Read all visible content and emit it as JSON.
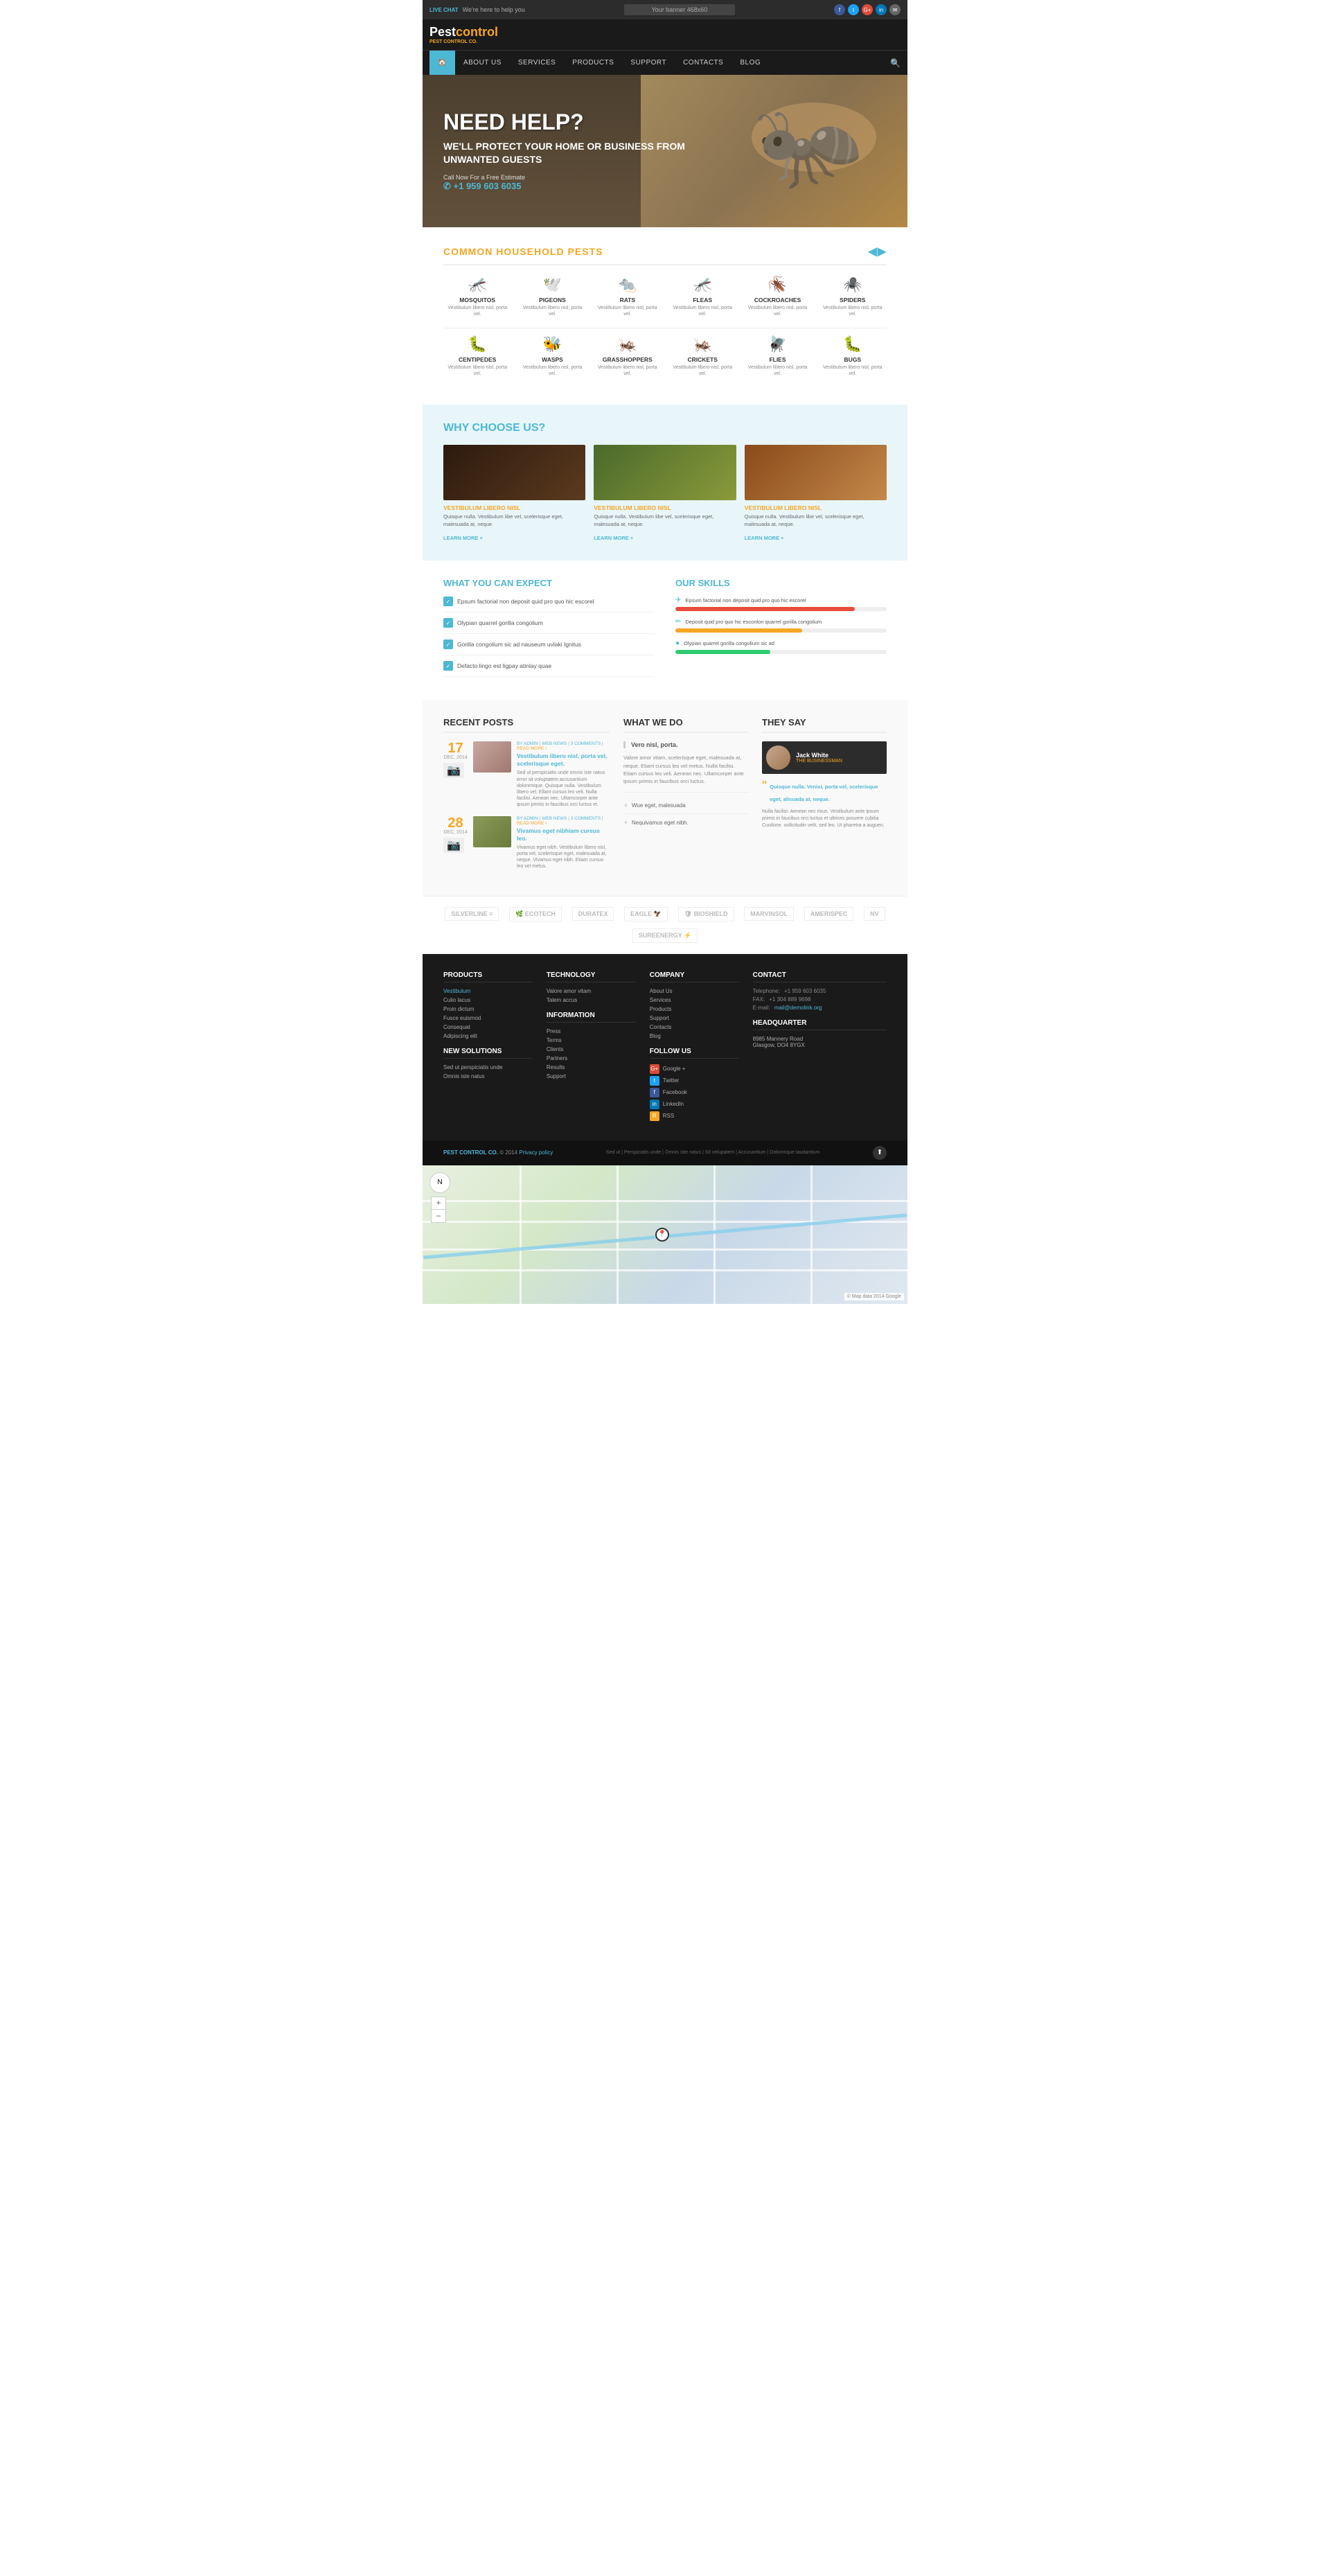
{
  "topbar": {
    "live_chat": "LIVE CHAT",
    "subtitle": "We're here to help you",
    "banner": "Your banner 468x60",
    "social": [
      "fb",
      "tw",
      "gp",
      "li",
      "em"
    ]
  },
  "logo": {
    "text_white": "Pest",
    "text_orange": "control",
    "tagline": "PEST CONTROL CO."
  },
  "nav": {
    "home": "🏠",
    "about": "ABOUT US",
    "services": "SERVICES",
    "products": "PRODUCTS",
    "support": "SUPPORT",
    "contacts": "CONTACTS",
    "blog": "BLOG"
  },
  "hero": {
    "title": "NEED HELP?",
    "subtitle": "WE'LL PROTECT YOUR HOME OR BUSINESS FROM UNWANTED GUESTS",
    "cta": "Call Now For a Free Estimate",
    "phone": "✆ +1 959 603 6035"
  },
  "pests": {
    "section_title": "COMMON HOUSEHOLD PESTS",
    "row1": [
      {
        "name": "MOSQUITOS",
        "desc": "Vestibulum libero nisl, porta vel."
      },
      {
        "name": "PIGEONS",
        "desc": "Vestibulum libero nisl, porta vel."
      },
      {
        "name": "RATS",
        "desc": "Vestibulum libero nisl, porta vel."
      },
      {
        "name": "FLEAS",
        "desc": "Vestibulum libero nisl, porta vel."
      },
      {
        "name": "COCKROACHES",
        "desc": "Vestibulum libero nisl, porta vel."
      },
      {
        "name": "SPIDERS",
        "desc": "Vestibulum libero nisl, porta vel."
      }
    ],
    "row2": [
      {
        "name": "CENTIPEDES",
        "desc": "Vestibulum libero nisl, porta vel."
      },
      {
        "name": "WASPS",
        "desc": "Vestibulum libero nisl, porta vel."
      },
      {
        "name": "GRASSHOPPERS",
        "desc": "Vestibulum libero nisl, porta vel."
      },
      {
        "name": "CRICKETS",
        "desc": "Vestibulum libero nisl, porta vel."
      },
      {
        "name": "FLIES",
        "desc": "Vestibulum libero nisl, porta vel."
      },
      {
        "name": "BUGS",
        "desc": "Vestibulum libero nisl, porta vel."
      }
    ],
    "icons_row1": [
      "🦟",
      "🕊️",
      "🐀",
      "🦟",
      "🪳",
      "🕷️"
    ],
    "icons_row2": [
      "🐛",
      "🐝",
      "🦗",
      "🦗",
      "🪰",
      "🐛"
    ]
  },
  "why": {
    "title": "WHY CHOOSE US?",
    "cards": [
      {
        "title": "VESTIBULUM LIBERO NISL",
        "text": "Quisque nulla. Vestibulum libe vel, scelerisque eget, malesuada at, neque.",
        "learn_more": "LEARN MORE +"
      },
      {
        "title": "VESTIBULUM LIBERO NISL",
        "text": "Quisque nulla. Vestibulum libe vel, scelerisque eget, malesuada at, neque.",
        "learn_more": "LEARN MORE +"
      },
      {
        "title": "VESTIBULUM LIBERO NISL",
        "text": "Quisque nulla. Vestibulum libe vel, scelerisque eget, malesuada at, neque.",
        "learn_more": "LEARN MORE +"
      }
    ]
  },
  "expect": {
    "title": "WHAT YOU CAN EXPECT",
    "items": [
      "Epsum factorial non deposit quid pro quo hic escorel",
      "Olypian quarrel  gorilla congolium",
      "Gorilla congolium sic ad nauseum uvlaki Ignitus",
      "Defacto lingo est ligpay atinlay quae"
    ]
  },
  "skills": {
    "title": "OUR SKILLS",
    "items": [
      {
        "icon": "✈",
        "label": "Epsum factorial non deposit quid pro quo hic escorel",
        "percent": 85,
        "color": "bar-red"
      },
      {
        "icon": "✏",
        "label": "Deposit quid pro quo hic esconlon quarrel  gorilla congolium",
        "percent": 60,
        "color": "bar-yellow"
      },
      {
        "icon": "●",
        "label": "Olypian quarrel  gorilla congolium sic ad",
        "percent": 45,
        "color": "bar-green"
      }
    ]
  },
  "recent_posts": {
    "title": "RECENT POSTS",
    "posts": [
      {
        "day": "17",
        "month": "DEC, 2014",
        "by": "BY ADMIN",
        "category": "WEB NEWS",
        "comments": "3 COMMENTS",
        "title": "Vestibulum libero nisl, porta vel, scelerisque eget.",
        "excerpt": "Sed ut perspiciatis unde omnis iste natus error sit voluptatem accusantium doloremque.\n\nQuisque nulla. Vestibulum libero vel. Ellam cursus leo veli. Nulla facilisi. Aenean nec. Ullamcorper ante ipsum primis in faucibus orci luctus et."
      },
      {
        "day": "28",
        "month": "DEC, 2014",
        "by": "BY ADMIN",
        "category": "WEB NEWS",
        "comments": "3 COMMENTS",
        "title": "Vivamus eget nibhiam cursus leo.",
        "excerpt": "Vivamus eget nibh. Vestibulum libero nisl, porta vel, scelerisque eget, malesuada at, neque. Vivamus eget nibh. Etiam cursus leo vel metus."
      }
    ]
  },
  "what_we_do": {
    "title": "WHAT WE DO",
    "main_text": "Vero nisl, porta.",
    "desc": "Valore amor vitam, scelerisque eget, malesuada at, neque. Etiam cursus leo vel metus. Nulla facilisi. Etiam cursus leo veli. Aenean nec. Ullamcorper ante ipsum primis in faucibus orci luctus.",
    "items": [
      "Wue eget, malesuada",
      "Nequivamus eget nibh."
    ]
  },
  "testimonial": {
    "title": "THEY SAY",
    "name": "Jack White",
    "role": "THE BUSINESSMAN",
    "quote_highlight": "Quisque nulla. Venisi, porta vel, scelerisque eget, alisuada at, neque.",
    "quote_full": "Nulla facilisi. Aenean nec risus. Vestibulum ante ipsum primis in faucibus orci luctus et ultrices posuere cubilia Cuoilone. sollicitudin velit, sed leo. Ut pharetra a auguen."
  },
  "partners": [
    "SilverLine",
    "EcoTech",
    "DuraTex",
    "Eagle",
    "BioShield",
    "MARVINSOL",
    "AmeriSpec",
    "NV",
    "SureEnergy"
  ],
  "footer": {
    "products": {
      "title": "PRODUCTS",
      "links": [
        "Vestibulum",
        "Culio lacus",
        "Proin dictum",
        "Fusce euismod",
        "Consequat",
        "Adipiscing elit"
      ],
      "new_solutions_title": "NEW SOLUTIONS",
      "new_solutions": [
        "Sed ut perspiciatis unde",
        "Omnis iste natus"
      ]
    },
    "technology": {
      "title": "TECHNOLOGY",
      "links": [
        "Valore amor vitam",
        "Talem accus"
      ],
      "info_title": "INFORMATION",
      "info_links": [
        "Press",
        "Terms",
        "Clients",
        "Partners",
        "Results",
        "Support"
      ]
    },
    "company": {
      "title": "COMPANY",
      "links": [
        "About Us",
        "Services",
        "Products",
        "Support",
        "Contacts",
        "Blog"
      ],
      "follow_title": "FOLLOW US",
      "follow_items": [
        {
          "icon": "G+",
          "label": "Google +",
          "color": "fi-gp"
        },
        {
          "icon": "t",
          "label": "Twitter",
          "color": "fi-tw"
        },
        {
          "icon": "f",
          "label": "Facebook",
          "color": "fi-fb"
        },
        {
          "icon": "in",
          "label": "LinkedIn",
          "color": "fi-li"
        },
        {
          "icon": "R",
          "label": "RSS",
          "color": "fi-rss"
        }
      ]
    },
    "contact": {
      "title": "CONTACT",
      "telephone_label": "Telephone:",
      "telephone": "+1 959 603 6035",
      "fax_label": "FAX:",
      "fax": "+1 304 889 9698",
      "email_label": "E-mail:",
      "email": "mail@demolink.org",
      "hq_title": "HEADQUARTER",
      "hq_address": "8985 Mannery Road\nGlasgow, DO4 8YGX"
    }
  },
  "footer_bottom": {
    "brand": "PEST CONTROL CO.",
    "copyright": "© 2014",
    "privacy": "Privacy policy",
    "links": "Sed ut | Perspiciatis unde | Omnis iste natus | Sit velupatem | Accusantium | Dolorimque laudantium"
  }
}
